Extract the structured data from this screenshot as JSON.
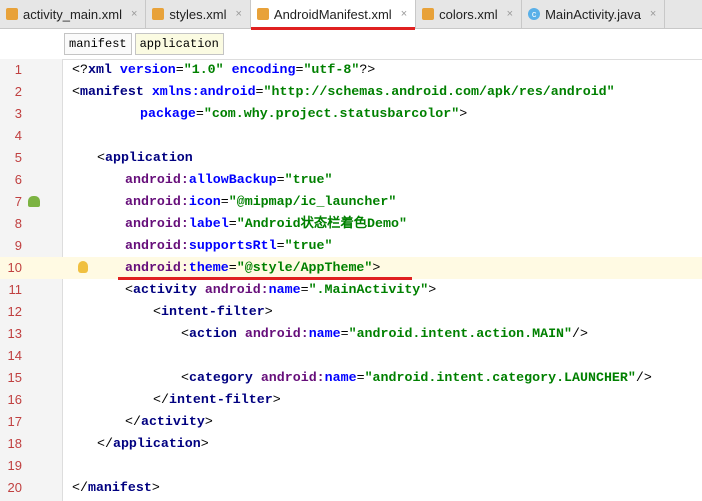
{
  "tabs": [
    {
      "label": "activity_main.xml",
      "icon": "xml-file-icon",
      "active": false
    },
    {
      "label": "styles.xml",
      "icon": "xml-file-icon",
      "active": false
    },
    {
      "label": "AndroidManifest.xml",
      "icon": "manifest-file-icon",
      "active": true
    },
    {
      "label": "colors.xml",
      "icon": "xml-file-icon",
      "active": false
    },
    {
      "label": "MainActivity.java",
      "icon": "class-icon",
      "active": false
    }
  ],
  "breadcrumbs": [
    "manifest",
    "application"
  ],
  "lines": [
    {
      "n": "1",
      "indent": 0,
      "t": [
        [
          "punct",
          "<?"
        ],
        [
          "tag",
          "xml "
        ],
        [
          "attr",
          "version"
        ],
        [
          "punct",
          "="
        ],
        [
          "value",
          "\"1.0\" "
        ],
        [
          "attr",
          "encoding"
        ],
        [
          "punct",
          "="
        ],
        [
          "value",
          "\"utf-8\""
        ],
        [
          "punct",
          "?>"
        ]
      ]
    },
    {
      "n": "2",
      "indent": 0,
      "t": [
        [
          "punct",
          "<"
        ],
        [
          "tag",
          "manifest "
        ],
        [
          "attr",
          "xmlns:android"
        ],
        [
          "punct",
          "="
        ],
        [
          "value",
          "\"http://schemas.android.com/apk/res/android\""
        ]
      ]
    },
    {
      "n": "3",
      "indent": 68,
      "t": [
        [
          "attr",
          "package"
        ],
        [
          "punct",
          "="
        ],
        [
          "value",
          "\"com.why.project.statusbarcolor\""
        ],
        [
          "punct",
          ">"
        ]
      ]
    },
    {
      "n": "4",
      "indent": 0,
      "t": []
    },
    {
      "n": "5",
      "indent": 25,
      "t": [
        [
          "punct",
          "<"
        ],
        [
          "tag",
          "application"
        ]
      ]
    },
    {
      "n": "6",
      "indent": 53,
      "t": [
        [
          "ns",
          "android:"
        ],
        [
          "attr",
          "allowBackup"
        ],
        [
          "punct",
          "="
        ],
        [
          "value",
          "\"true\""
        ]
      ]
    },
    {
      "n": "7",
      "indent": 53,
      "t": [
        [
          "ns",
          "android:"
        ],
        [
          "attr",
          "icon"
        ],
        [
          "punct",
          "="
        ],
        [
          "value",
          "\"@mipmap/ic_launcher\""
        ]
      ]
    },
    {
      "n": "8",
      "indent": 53,
      "t": [
        [
          "ns",
          "android:"
        ],
        [
          "attr",
          "label"
        ],
        [
          "punct",
          "="
        ],
        [
          "value",
          "\"Android状态栏着色Demo\""
        ]
      ]
    },
    {
      "n": "9",
      "indent": 53,
      "t": [
        [
          "ns",
          "android:"
        ],
        [
          "attr",
          "supportsRtl"
        ],
        [
          "punct",
          "="
        ],
        [
          "value",
          "\"true\""
        ]
      ]
    },
    {
      "n": "10",
      "indent": 53,
      "t": [
        [
          "ns",
          "android:"
        ],
        [
          "attr",
          "theme"
        ],
        [
          "punct",
          "="
        ],
        [
          "value",
          "\"@style/AppTheme\""
        ],
        [
          "punct",
          ">"
        ]
      ]
    },
    {
      "n": "11",
      "indent": 53,
      "t": [
        [
          "punct",
          "<"
        ],
        [
          "tag",
          "activity "
        ],
        [
          "ns",
          "android:"
        ],
        [
          "attr",
          "name"
        ],
        [
          "punct",
          "="
        ],
        [
          "value",
          "\".MainActivity\""
        ],
        [
          "punct",
          ">"
        ]
      ]
    },
    {
      "n": "12",
      "indent": 81,
      "t": [
        [
          "punct",
          "<"
        ],
        [
          "tag",
          "intent-filter"
        ],
        [
          "punct",
          ">"
        ]
      ]
    },
    {
      "n": "13",
      "indent": 109,
      "t": [
        [
          "punct",
          "<"
        ],
        [
          "tag",
          "action "
        ],
        [
          "ns",
          "android:"
        ],
        [
          "attr",
          "name"
        ],
        [
          "punct",
          "="
        ],
        [
          "value",
          "\"android.intent.action.MAIN\""
        ],
        [
          "punct",
          "/>"
        ]
      ]
    },
    {
      "n": "14",
      "indent": 0,
      "t": []
    },
    {
      "n": "15",
      "indent": 109,
      "t": [
        [
          "punct",
          "<"
        ],
        [
          "tag",
          "category "
        ],
        [
          "ns",
          "android:"
        ],
        [
          "attr",
          "name"
        ],
        [
          "punct",
          "="
        ],
        [
          "value",
          "\"android.intent.category.LAUNCHER\""
        ],
        [
          "punct",
          "/>"
        ]
      ]
    },
    {
      "n": "16",
      "indent": 81,
      "t": [
        [
          "punct",
          "</"
        ],
        [
          "tag",
          "intent-filter"
        ],
        [
          "punct",
          ">"
        ]
      ]
    },
    {
      "n": "17",
      "indent": 53,
      "t": [
        [
          "punct",
          "</"
        ],
        [
          "tag",
          "activity"
        ],
        [
          "punct",
          ">"
        ]
      ]
    },
    {
      "n": "18",
      "indent": 25,
      "t": [
        [
          "punct",
          "</"
        ],
        [
          "tag",
          "application"
        ],
        [
          "punct",
          ">"
        ]
      ]
    },
    {
      "n": "19",
      "indent": 0,
      "t": []
    },
    {
      "n": "20",
      "indent": 0,
      "t": [
        [
          "punct",
          "</"
        ],
        [
          "tag",
          "manifest"
        ],
        [
          "punct",
          ">"
        ]
      ]
    }
  ],
  "highlighted_line": "10"
}
